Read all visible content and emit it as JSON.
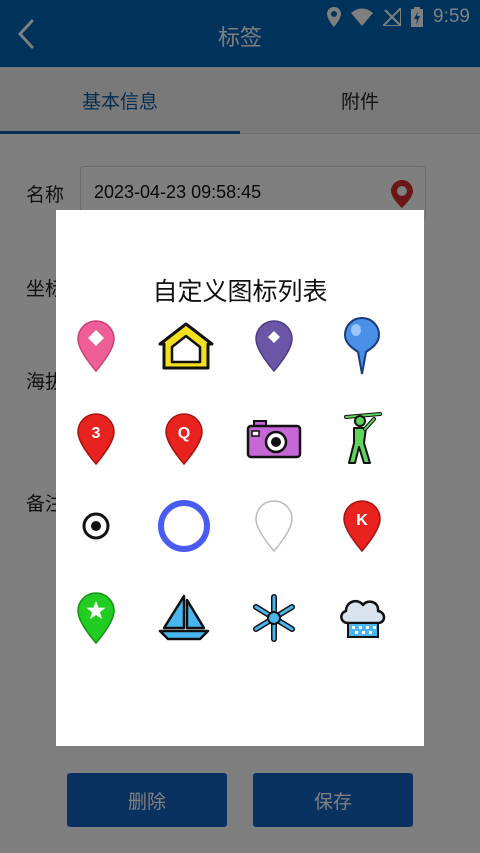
{
  "status_bar": {
    "time": "9:59"
  },
  "header": {
    "title": "标签"
  },
  "tabs": [
    {
      "label": "基本信息",
      "active": true
    },
    {
      "label": "附件",
      "active": false
    }
  ],
  "form": {
    "name_label": "名称",
    "name_value": "2023-04-23 09:58:45",
    "coord_label": "坐标",
    "altitude_label": "海拔",
    "remark_label": "备注"
  },
  "buttons": {
    "delete": "删除",
    "save": "保存"
  },
  "dialog": {
    "title": "自定义图标列表",
    "icons": [
      "pink-diamond-pin-icon",
      "yellow-house-icon",
      "purple-diamond-pin-icon",
      "blue-push-pin-icon",
      "red-number-3-pin-icon",
      "red-letter-q-pin-icon",
      "camera-icon",
      "golfer-icon",
      "target-dot-icon",
      "blue-ring-icon",
      "white-pin-icon",
      "red-letter-k-pin-icon",
      "green-star-pin-icon",
      "sailboat-icon",
      "snowflake-icon",
      "snow-cloud-icon"
    ]
  },
  "colors": {
    "primary": "#0066b8",
    "tab_active": "#0a5ca6",
    "button": "#1565c0"
  }
}
